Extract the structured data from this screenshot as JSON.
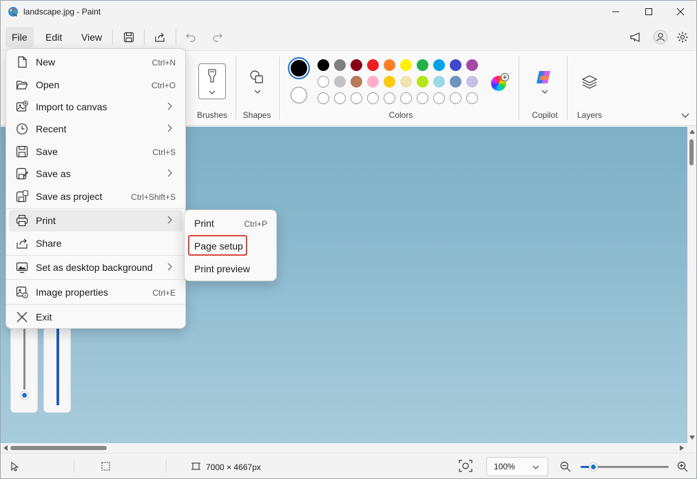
{
  "window": {
    "title": "landscape.jpg - Paint"
  },
  "menubar": {
    "file": "File",
    "edit": "Edit",
    "view": "View"
  },
  "ribbon": {
    "groups": {
      "brushes": "Brushes",
      "shapes": "Shapes",
      "colors": "Colors",
      "copilot": "Copilot",
      "layers": "Layers"
    },
    "primary_color": "#000000",
    "secondary_color": "#ffffff",
    "palette_row1": [
      "#000000",
      "#7f7f7f",
      "#880015",
      "#ed1c24",
      "#ff7f27",
      "#fff200",
      "#22b14c",
      "#00a2e8",
      "#3f48cc",
      "#a349a4"
    ],
    "palette_row2": [
      "#ffffff",
      "#c3c3c3",
      "#b97a57",
      "#ffaec9",
      "#ffc90e",
      "#efe4b0",
      "#b5e61d",
      "#99d9ea",
      "#7092be",
      "#c8bfe7"
    ],
    "palette_row3_count": 10
  },
  "file_menu": {
    "items": [
      {
        "label": "New",
        "shortcut": "Ctrl+N",
        "icon": "new-file-icon"
      },
      {
        "label": "Open",
        "shortcut": "Ctrl+O",
        "icon": "folder-open-icon"
      },
      {
        "label": "Import to canvas",
        "submenu": true,
        "icon": "import-icon"
      },
      {
        "label": "Recent",
        "submenu": true,
        "icon": "clock-icon"
      },
      {
        "label": "Save",
        "shortcut": "Ctrl+S",
        "icon": "save-icon"
      },
      {
        "label": "Save as",
        "submenu": true,
        "icon": "save-as-icon"
      },
      {
        "label": "Save as project",
        "shortcut": "Ctrl+Shift+S",
        "icon": "save-project-icon"
      },
      {
        "label": "Print",
        "submenu": true,
        "icon": "printer-icon"
      },
      {
        "label": "Share",
        "icon": "share-icon"
      },
      {
        "label": "Set as desktop background",
        "submenu": true,
        "icon": "desktop-background-icon"
      },
      {
        "label": "Image properties",
        "shortcut": "Ctrl+E",
        "icon": "image-properties-icon"
      },
      {
        "label": "Exit",
        "icon": "close-icon"
      }
    ]
  },
  "print_submenu": {
    "items": [
      {
        "label": "Print",
        "shortcut": "Ctrl+P"
      },
      {
        "label": "Page setup"
      },
      {
        "label": "Print preview"
      }
    ]
  },
  "statusbar": {
    "dimensions": "7000 × 4667px",
    "zoom": "100%",
    "zoom_slider_fraction": 0.1
  }
}
